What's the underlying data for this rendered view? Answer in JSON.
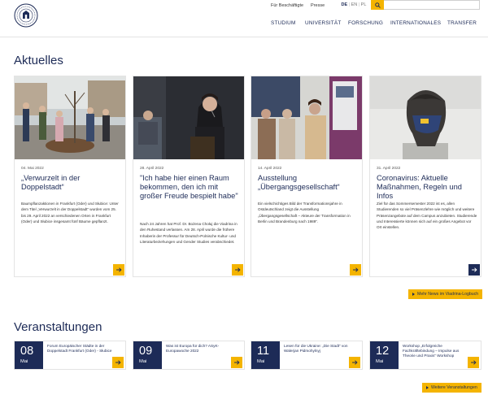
{
  "header": {
    "meta_links": [
      "Für Beschäftigte",
      "Presse"
    ],
    "languages": [
      "DE",
      "EN",
      "PL"
    ],
    "active_language": "DE",
    "search_icon": "search-icon",
    "search_placeholder": "",
    "nav": [
      "STUDIUM",
      "UNIVERSITÄT",
      "FORSCHUNG",
      "INTERNATIONALES",
      "TRANSFER"
    ]
  },
  "news": {
    "title": "Aktuelles",
    "cards": [
      {
        "date": "04. Mai 2022",
        "title": "„Verwurzelt in der Doppelstadt“",
        "text": "Baumpflanzaktionen in Frankfurt (Oder) und Słubice: Unter dem Titel „Verwurzelt in der Doppelstadt“ wurden vom 25. bis 29. April 2022 an verschiedenen Orten in Frankfurt (Oder) und Słubice insgesamt fünf Bäume gepflanzt."
      },
      {
        "date": "28. April 2022",
        "title": "\"Ich habe hier einen Raum bekommen, den ich mit großer Freude bespielt habe\"",
        "text": "Nach 24 Jahren hat Prof. Dr. Bożena Chołuj die Viadrina in den Ruhestand verlassen. Am 28. April wurde die frühere Inhaberin der Professur für Deutsch-Polnische Kultur- und Literaturbeziehungen und Gender Studies verabschiedet."
      },
      {
        "date": "14. April 2022",
        "title": "Ausstellung „Übergangsgesellschaft“",
        "text": "Ein vielschichtiges Bild der Transformationsjahre in Ostdeutschland zeigt die Ausstellung „Übergangsgesellschaft – Akteure der Transformation in Berlin und Brandenburg nach 1989“."
      },
      {
        "date": "31. April 2022",
        "title": "Coronavirus: Aktuelle Maßnahmen, Regeln und Infos",
        "text": "Ziel für das Sommersemester 2022 ist es, allen Studierenden so viel Präsenzlehre wie möglich und weitere Präsenzangebote auf dem Campus anzubieten. Studierende und Interessierte können sich auf ein großes Angebot vor Ort einstellen."
      }
    ],
    "more_label": "Mehr News im Viadrina-Logbuch",
    "arrow_icon": "arrow-right-icon"
  },
  "events": {
    "title": "Veranstaltungen",
    "items": [
      {
        "day": "08",
        "month": "Mai",
        "text": "Forum Europäischer Städte in der Doppelstadt Frankfurt (Oder) - Słubice"
      },
      {
        "day": "09",
        "month": "Mai",
        "text": "Was ist Europa für dich? ASyK-Europawoche 2022"
      },
      {
        "day": "11",
        "month": "Mai",
        "text": "Lesen für die Ukraine: „Die Stadt“ von Walerjan Pidmohylnyj"
      },
      {
        "day": "12",
        "month": "Mai",
        "text": "Workshop „Erfolgreiche Fachkräftebindung – Impulse aus Theorie und Praxis“ Workshop"
      }
    ],
    "more_label": "Weitere Veranstaltungen"
  },
  "colors": {
    "navy": "#1d2b57",
    "yellow": "#f4b400",
    "border": "#e4e4e4"
  }
}
